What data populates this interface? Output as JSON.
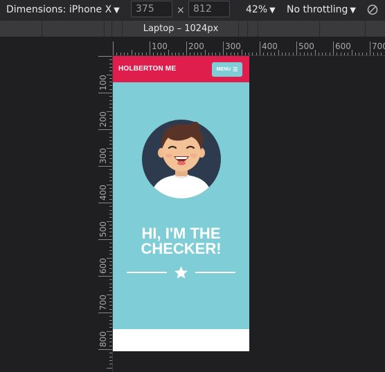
{
  "device_toolbar": {
    "dimensions_label": "Dimensions: iPhone X",
    "width": "375",
    "height": "812",
    "times": "×",
    "zoom": "42%",
    "throttling": "No throttling",
    "caret": "▼"
  },
  "media_queries": {
    "active_label": "Laptop – 1024px"
  },
  "rulers": {
    "horizontal": [
      "100",
      "200",
      "300",
      "400",
      "500",
      "600",
      "700"
    ],
    "vertical": [
      "100",
      "200",
      "300",
      "400",
      "500",
      "600",
      "700",
      "800"
    ]
  },
  "page": {
    "header": {
      "logo": "HOLBERTON ME",
      "menu_label": "MENU",
      "menu_icon": "hamburger-icon"
    },
    "hero": {
      "title_line1": "HI, I'M THE",
      "title_line2": "CHECKER!",
      "divider_icon": "star-icon",
      "avatar_icon": "smiling-boy-avatar"
    }
  },
  "colors": {
    "header_bg": "#e01e4d",
    "hero_bg": "#7fcdd6",
    "avatar_circle": "#2e3b4e",
    "devtools_bg": "#1f1f22"
  }
}
